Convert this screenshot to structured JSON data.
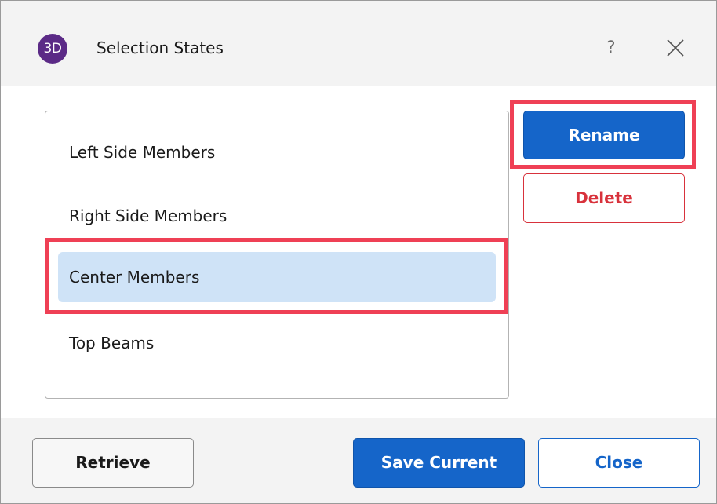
{
  "dialog": {
    "icon_text": "3D",
    "title": "Selection States",
    "help_label": "?"
  },
  "list": {
    "items": [
      {
        "label": "Left Side Members",
        "selected": false
      },
      {
        "label": "Right Side Members",
        "selected": false
      },
      {
        "label": "Center Members",
        "selected": true
      },
      {
        "label": "Top Beams",
        "selected": false
      }
    ]
  },
  "side_buttons": {
    "rename_label": "Rename",
    "delete_label": "Delete"
  },
  "footer": {
    "retrieve_label": "Retrieve",
    "save_current_label": "Save Current",
    "close_label": "Close"
  },
  "colors": {
    "accent": "#1565c9",
    "danger": "#d8323c",
    "highlight": "#ef4055",
    "selection": "#cfe3f7",
    "app_icon": "#5b2a86"
  }
}
